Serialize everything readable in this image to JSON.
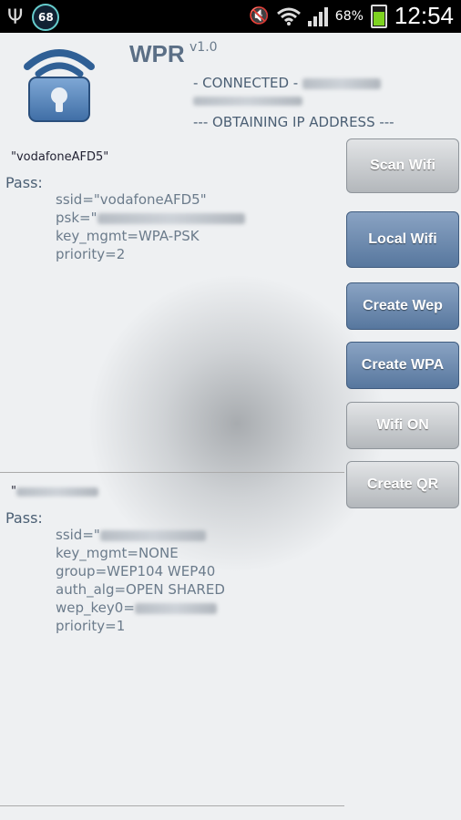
{
  "status_bar": {
    "notification_count": "68",
    "battery_percent": "68%",
    "battery_level": 0.68,
    "time": "12:54"
  },
  "app": {
    "title": "WPR",
    "version": "v1.0"
  },
  "connection": {
    "status_prefix": "- CONNECTED -",
    "ip_status": "--- OBTAINING IP ADDRESS ---"
  },
  "networks": [
    {
      "name": "\"vodafoneAFD5\"",
      "pass_label": "Pass:",
      "lines": [
        "ssid=\"vodafoneAFD5\"",
        "psk=\"",
        "key_mgmt=WPA-PSK",
        "priority=2"
      ]
    },
    {
      "name": "\"",
      "pass_label": "Pass:",
      "lines": [
        "ssid=\"",
        "key_mgmt=NONE",
        "group=WEP104 WEP40",
        "auth_alg=OPEN SHARED",
        "wep_key0=",
        "priority=1"
      ]
    }
  ],
  "buttons": {
    "scan_wifi": "Scan Wifi",
    "local_wifi": "Local Wifi",
    "create_wep": "Create Wep",
    "create_wpa": "Create WPA",
    "wifi_on": "Wifi ON",
    "create_qr": "Create QR"
  },
  "colors": {
    "button_blue": "#57779e",
    "button_gray": "#b3b7bb",
    "background": "#eef0f2"
  }
}
